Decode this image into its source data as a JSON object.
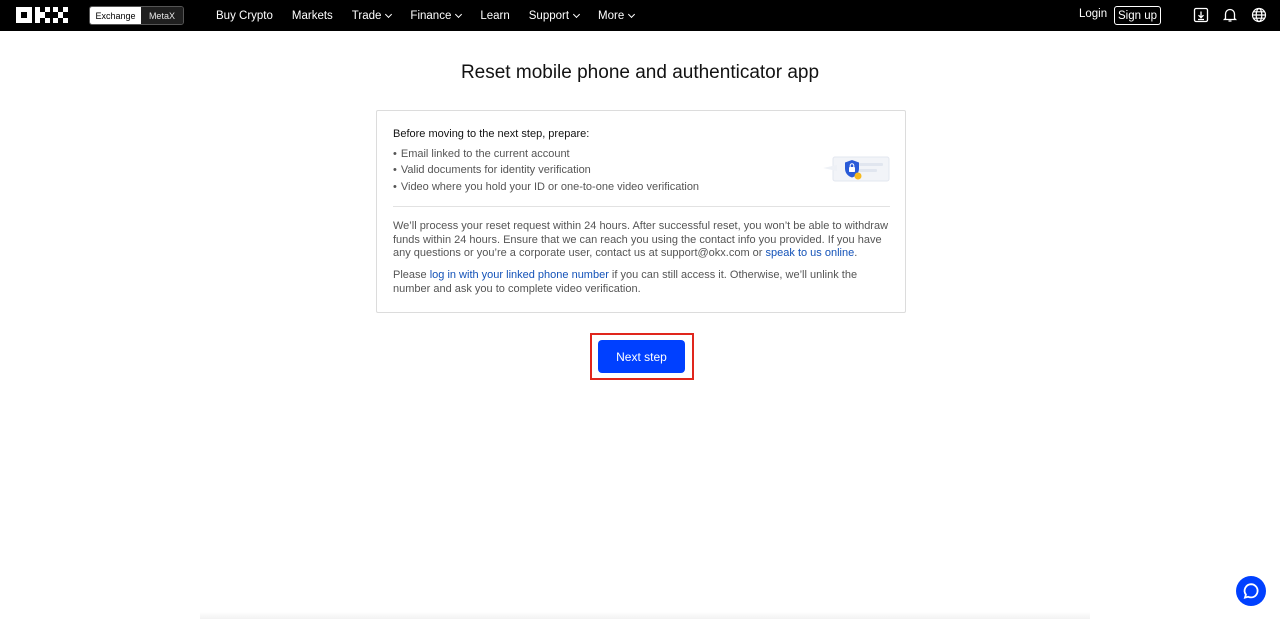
{
  "nav": {
    "brand": "OKX",
    "toggle": {
      "active": "Exchange",
      "inactive": "MetaX"
    },
    "menu": [
      {
        "label": "Buy Crypto",
        "dropdown": false
      },
      {
        "label": "Markets",
        "dropdown": false
      },
      {
        "label": "Trade",
        "dropdown": true
      },
      {
        "label": "Finance",
        "dropdown": true
      },
      {
        "label": "Learn",
        "dropdown": false
      },
      {
        "label": "Support",
        "dropdown": true
      },
      {
        "label": "More",
        "dropdown": true
      }
    ],
    "login": "Login",
    "signup": "Sign up",
    "icons": [
      "download-icon",
      "bell-icon",
      "globe-icon"
    ]
  },
  "page": {
    "title": "Reset mobile phone and authenticator app",
    "prepare_heading": "Before moving to the next step, prepare:",
    "requirements": [
      "Email linked to the current account",
      "Valid documents for identity verification",
      "Video where you hold your ID or one-to-one video verification"
    ],
    "para1_text": "We’ll process your reset request within 24 hours. After successful reset, you won’t be able to withdraw funds within 24 hours. Ensure that we can reach you using the contact info you provided. If you have any questions or you’re a corporate user, contact us at support@okx.com or ",
    "para1_link": "speak to us online",
    "para1_end": ".",
    "para2_start": "Please ",
    "para2_link": "log in with your linked phone number",
    "para2_end": " if you can still access it. Otherwise, we’ll unlink the number and ask you to complete video verification.",
    "next_button": "Next step"
  },
  "colors": {
    "nav_bg": "#000000",
    "primary": "#0040ff",
    "link": "#1352b8",
    "highlight_border": "#e0261d"
  }
}
